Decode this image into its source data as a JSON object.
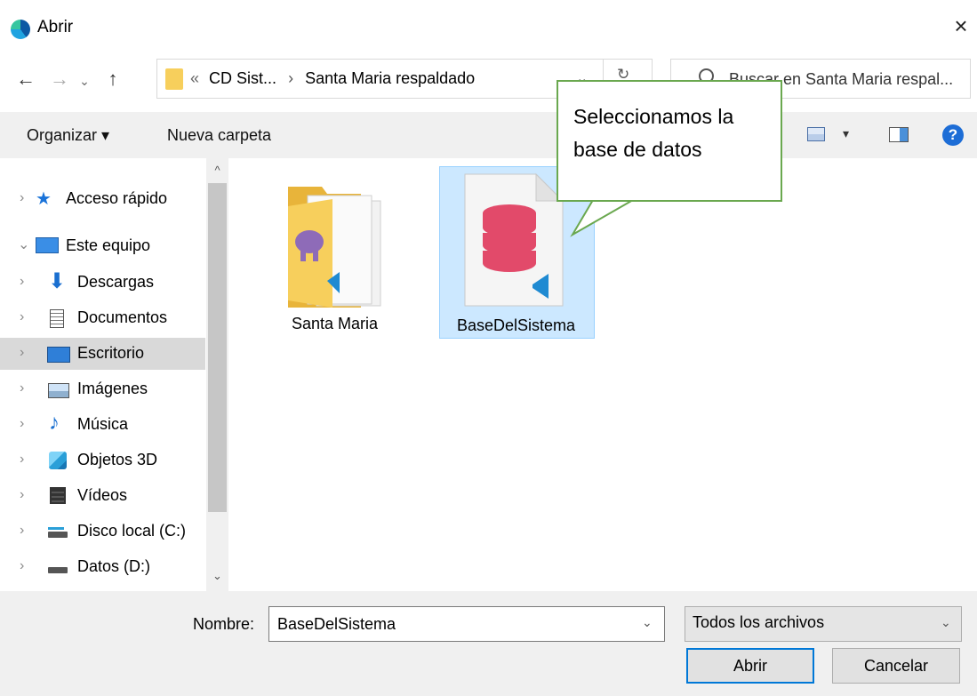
{
  "window": {
    "title": "Abrir",
    "close_glyph": "×"
  },
  "nav": {
    "back": "←",
    "forward": "→",
    "recent": "⌄",
    "up": "↑",
    "refresh": "↻"
  },
  "address": {
    "prefix": "«",
    "parent": "CD Sist...",
    "separator": "›",
    "current": "Santa Maria respaldado",
    "chevron": "⌄"
  },
  "search": {
    "placeholder": "Buscar en Santa Maria respal..."
  },
  "toolbar": {
    "organize_label": "Organizar ▾",
    "new_folder_label": "Nueva carpeta",
    "help": "?"
  },
  "sidebar": {
    "items": [
      {
        "label": "Acceso rápido",
        "icon": "star-icon",
        "chevron": "›"
      },
      {
        "label": "Este equipo",
        "icon": "computer-icon",
        "chevron": "⌄"
      },
      {
        "label": "Descargas",
        "icon": "download-icon",
        "chevron": "›"
      },
      {
        "label": "Documentos",
        "icon": "document-icon",
        "chevron": "›"
      },
      {
        "label": "Escritorio",
        "icon": "desktop-icon",
        "chevron": "›",
        "selected": true
      },
      {
        "label": "Imágenes",
        "icon": "pictures-icon",
        "chevron": "›"
      },
      {
        "label": "Música",
        "icon": "music-icon",
        "chevron": "›"
      },
      {
        "label": "Objetos 3D",
        "icon": "cube-icon",
        "chevron": "›"
      },
      {
        "label": "Vídeos",
        "icon": "video-icon",
        "chevron": "›"
      },
      {
        "label": "Disco local (C:)",
        "icon": "drive-c-icon",
        "chevron": "›"
      },
      {
        "label": "Datos (D:)",
        "icon": "drive-d-icon",
        "chevron": "›"
      }
    ],
    "scroll_up": "^",
    "scroll_down": "⌄"
  },
  "files": [
    {
      "name": "Santa Maria",
      "type": "folder",
      "icon": "folder-icon"
    },
    {
      "name": "BaseDelSistema",
      "type": "database",
      "icon": "database-icon",
      "selected": true
    }
  ],
  "callout": {
    "line1": "Seleccionamos la",
    "line2": "base de datos",
    "border_color": "#6aa84f"
  },
  "footer": {
    "name_label": "Nombre:",
    "name_value": "BaseDelSistema",
    "filetype_value": "Todos los archivos",
    "open_label": "Abrir",
    "cancel_label": "Cancelar",
    "chevron": "⌄"
  },
  "colors": {
    "accent": "#0078d7",
    "selection": "#cce8ff",
    "db_red": "#e24a6a",
    "vscode_blue": "#1f8ad2"
  }
}
